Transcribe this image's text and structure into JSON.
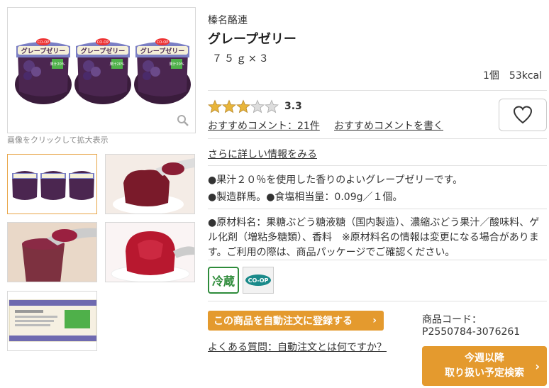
{
  "gallery": {
    "caption": "画像をクリックして拡大表示"
  },
  "product": {
    "maker": "榛名酪連",
    "name": "グレープゼリー",
    "spec": "７５ｇ×３",
    "calories": "1個　53kcal",
    "rating": "3.3",
    "rating_value": 3.3,
    "rating_max": 5,
    "comment_count_link": "おすすめコメント：21件",
    "write_comment_link": "おすすめコメントを書く",
    "more_info_link": "さらに詳しい情報をみる",
    "desc1": "●果汁２０％を使用した香りのよいグレープゼリーです。",
    "desc2": "●製造群馬。●食塩相当量：0.09g／１個。",
    "desc3": "●原材料名：果糖ぶどう糖液糖（国内製造）、濃縮ぶどう果汁／酸味料、ゲル化剤（増粘多糖類）、香料　※原材料名の情報は変更になる場合があります。ご利用の際は、商品パッケージでご確認ください。",
    "badge_reizo": "冷蔵",
    "badge_coop": "CO-OP",
    "auto_order_button": "この商品を自動注文に登録する",
    "faq_link": "よくある質問：自動注文とは何ですか？",
    "code_label": "商品コード：",
    "code_value": "P2550784-3076261",
    "schedule_line1": "今週以降",
    "schedule_line2": "取り扱い予定検索"
  },
  "cup_label": "グレープゼリー",
  "cup_brand": "CO-OP",
  "cup_juice": "果汁20%",
  "colors": {
    "accent": "#e49a2e",
    "reizo_green": "#2e8b3a",
    "star": "#e8b53a"
  }
}
